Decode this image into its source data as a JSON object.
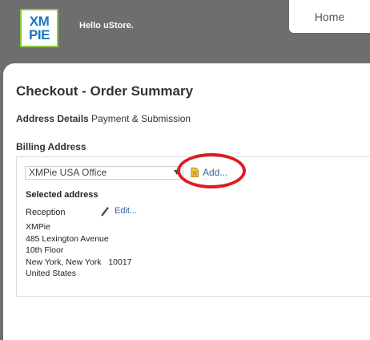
{
  "header": {
    "logo": {
      "line1": "XM",
      "line2": "PIE"
    },
    "greeting": "Hello uStore.",
    "home_tab": "Home"
  },
  "colors": {
    "header_bg": "#6e6e6e",
    "logo_border": "#8dc63f",
    "logo_text": "#1b75bc",
    "link": "#336699",
    "highlight_circle": "#e11b22"
  },
  "page": {
    "title": "Checkout - Order Summary",
    "steps": {
      "active": "Address Details",
      "rest": "Payment & Submission"
    }
  },
  "billing": {
    "heading": "Billing Address",
    "select_value": "XMPie USA Office",
    "add_label": "Add...",
    "add_icon": "document-icon",
    "selected_label": "Selected address",
    "name": "Reception",
    "edit_label": "Edit...",
    "edit_icon": "pencil-icon",
    "address_lines": [
      "XMPie",
      "485 Lexington Avenue",
      "10th Floor",
      "New York, New York   10017",
      "United States"
    ]
  }
}
